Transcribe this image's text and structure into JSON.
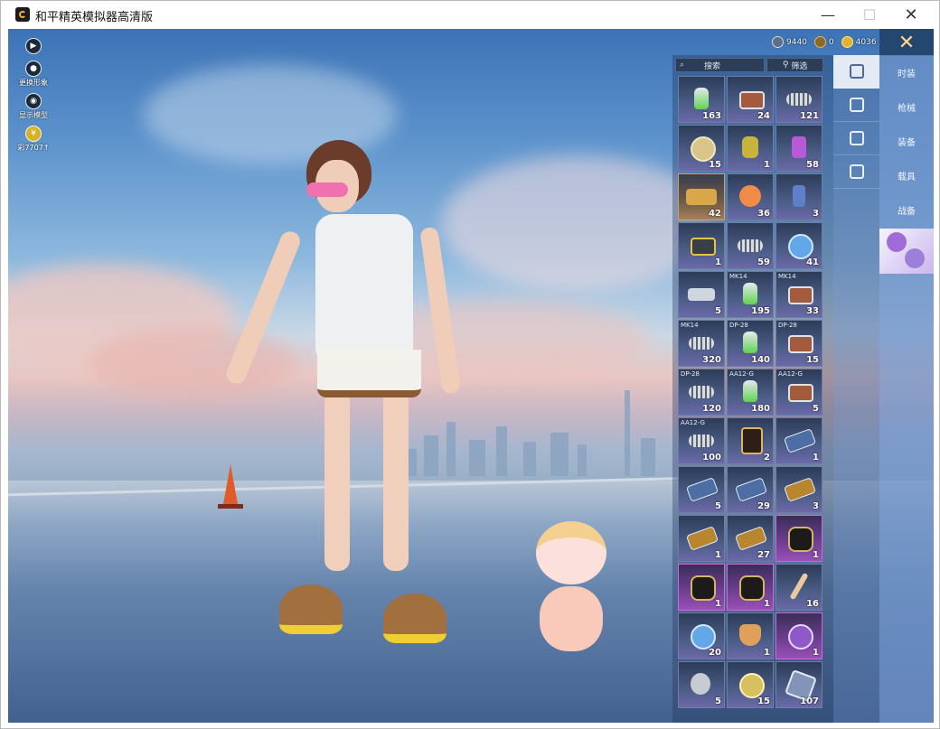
{
  "window": {
    "title": "和平精英模拟器高清版",
    "controls": {
      "minimize": "—",
      "maximize": "☐",
      "close": "✕"
    }
  },
  "hud": {
    "left": [
      {
        "label": "",
        "icon": "play-icon"
      },
      {
        "label": "更换形象",
        "icon": "avatar-icon"
      },
      {
        "label": "显示模型",
        "icon": "eye-icon"
      },
      {
        "label": "彩7707↑",
        "icon": "coin-icon"
      }
    ],
    "currency": [
      {
        "value": "9440",
        "icon": "silver-coin-icon"
      },
      {
        "value": "0",
        "icon": "bronze-coin-icon"
      },
      {
        "value": "4036",
        "icon": "gold-coin-icon"
      }
    ],
    "close": "✕"
  },
  "inventory": {
    "search_label": "搜索",
    "filter_label": "筛选",
    "items": [
      {
        "icon": "green-canister-icon",
        "qty": "163",
        "tag": "",
        "style": ""
      },
      {
        "icon": "loot-box-icon",
        "qty": "24",
        "tag": "",
        "style": ""
      },
      {
        "icon": "spring-icon",
        "qty": "121",
        "tag": "",
        "style": ""
      },
      {
        "icon": "compass-icon",
        "qty": "15",
        "tag": "",
        "style": ""
      },
      {
        "icon": "grenade-icon",
        "qty": "1",
        "tag": "",
        "style": ""
      },
      {
        "icon": "spray-can-icon",
        "qty": "58",
        "tag": "",
        "style": ""
      },
      {
        "icon": "ticket-icon",
        "qty": "42",
        "tag": "",
        "style": "gold"
      },
      {
        "icon": "medal-icon",
        "qty": "36",
        "tag": "",
        "style": ""
      },
      {
        "icon": "spray-bottle-icon",
        "qty": "3",
        "tag": "",
        "style": ""
      },
      {
        "icon": "crate-icon",
        "qty": "1",
        "tag": "",
        "style": ""
      },
      {
        "icon": "spring-icon",
        "qty": "59",
        "tag": "",
        "style": ""
      },
      {
        "icon": "orb-icon",
        "qty": "41",
        "tag": "",
        "style": ""
      },
      {
        "icon": "parts-icon",
        "qty": "5",
        "tag": "",
        "style": ""
      },
      {
        "icon": "green-canister-icon",
        "qty": "195",
        "tag": "MK14",
        "style": ""
      },
      {
        "icon": "loot-box-icon",
        "qty": "33",
        "tag": "MK14",
        "style": ""
      },
      {
        "icon": "spring-icon",
        "qty": "320",
        "tag": "MK14",
        "style": ""
      },
      {
        "icon": "green-canister-icon",
        "qty": "140",
        "tag": "DP-28",
        "style": ""
      },
      {
        "icon": "loot-box-icon",
        "qty": "15",
        "tag": "DP-28",
        "style": ""
      },
      {
        "icon": "spring-icon",
        "qty": "120",
        "tag": "DP-28",
        "style": ""
      },
      {
        "icon": "green-canister-icon",
        "qty": "180",
        "tag": "AA12-G",
        "style": ""
      },
      {
        "icon": "loot-box-icon",
        "qty": "5",
        "tag": "AA12-G",
        "style": ""
      },
      {
        "icon": "spring-icon",
        "qty": "100",
        "tag": "AA12-G",
        "style": ""
      },
      {
        "icon": "card-icon",
        "qty": "2",
        "tag": "",
        "style": ""
      },
      {
        "icon": "coupon-icon",
        "qty": "1",
        "tag": "",
        "style": ""
      },
      {
        "icon": "coupon-icon",
        "qty": "5",
        "tag": "",
        "style": ""
      },
      {
        "icon": "coupon-icon",
        "qty": "29",
        "tag": "",
        "style": ""
      },
      {
        "icon": "gold-coupon-icon",
        "qty": "3",
        "tag": "",
        "style": ""
      },
      {
        "icon": "gold-coupon-icon",
        "qty": "1",
        "tag": "",
        "style": ""
      },
      {
        "icon": "gold-coupon-icon",
        "qty": "27",
        "tag": "",
        "style": ""
      },
      {
        "icon": "lion-crest-icon",
        "qty": "1",
        "tag": "",
        "style": "purple"
      },
      {
        "icon": "lion-crest-icon",
        "qty": "1",
        "tag": "",
        "style": "purple"
      },
      {
        "icon": "lion-crest-icon",
        "qty": "1",
        "tag": "",
        "style": "purple"
      },
      {
        "icon": "stick-icon",
        "qty": "16",
        "tag": "",
        "style": ""
      },
      {
        "icon": "orb-icon",
        "qty": "20",
        "tag": "",
        "style": ""
      },
      {
        "icon": "shield-badge-icon",
        "qty": "1",
        "tag": "",
        "style": ""
      },
      {
        "icon": "pony-badge-icon",
        "qty": "1",
        "tag": "",
        "style": "purple"
      },
      {
        "icon": "chrome-ball-icon",
        "qty": "5",
        "tag": "",
        "style": ""
      },
      {
        "icon": "gold-coin-icon",
        "qty": "15",
        "tag": "",
        "style": ""
      },
      {
        "icon": "gem-icon",
        "qty": "107",
        "tag": "",
        "style": ""
      }
    ]
  },
  "categories": [
    {
      "icon": "card-category-icon",
      "active": true
    },
    {
      "icon": "chest-category-icon",
      "active": false
    },
    {
      "icon": "burst-category-icon",
      "active": false
    },
    {
      "icon": "tag-category-icon",
      "active": false
    }
  ],
  "tabs": [
    "时装",
    "枪械",
    "装备",
    "载具",
    "战备"
  ],
  "colors": {
    "panel": "#6e91c8",
    "active_tab": "#ffffff",
    "close_bg": "#23476f",
    "accent_gold": "#ffd88a"
  }
}
